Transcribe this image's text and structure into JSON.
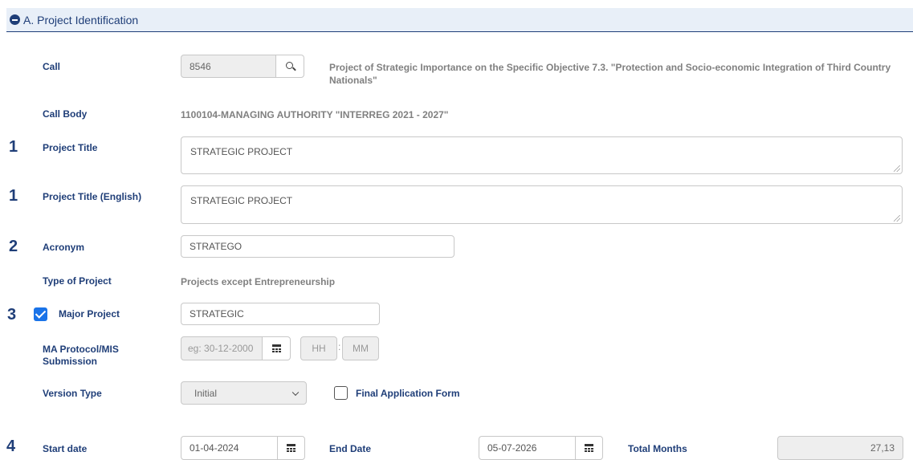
{
  "section": {
    "title": "A. Project Identification"
  },
  "call": {
    "label": "Call",
    "code": "8546",
    "description": "Project of Strategic Importance on the Specific Objective 7.3. \"Protection and Socio-economic Integration of Third Country Nationals\""
  },
  "call_body": {
    "label": "Call Body",
    "value": "1100104-MANAGING AUTHORITY \"INTERREG 2021 - 2027\""
  },
  "project_title": {
    "marker": "1",
    "label": "Project Title",
    "value": "STRATEGIC PROJECT"
  },
  "project_title_en": {
    "marker": "1",
    "label": "Project Title (English)",
    "value": "STRATEGIC PROJECT"
  },
  "acronym": {
    "marker": "2",
    "label": "Acronym",
    "value": "STRATEGO"
  },
  "type_of_project": {
    "label": "Type of Project",
    "value": "Projects except Entrepreneurship"
  },
  "major_project": {
    "marker": "3",
    "label": "Major Project",
    "checked": true,
    "value": "STRATEGIC"
  },
  "ma_protocol": {
    "label_line1": "MA Protocol/MIS",
    "label_line2": "Submission",
    "date_placeholder": "eg: 30-12-2000",
    "hour_placeholder": "HH",
    "minute_placeholder": "MM",
    "separator": ":"
  },
  "version_type": {
    "label": "Version Type",
    "selected": "Initial",
    "final_form_label": "Final Application Form",
    "final_form_checked": false
  },
  "dates": {
    "marker": "4",
    "start_label": "Start date",
    "start_value": "01-04-2024",
    "end_label": "End Date",
    "end_value": "05-07-2026",
    "total_label": "Total Months",
    "total_value": "27,13"
  },
  "colors": {
    "accent": "#1f3e78",
    "header_bg": "#e8eff8",
    "checkbox": "#1a73e8"
  }
}
